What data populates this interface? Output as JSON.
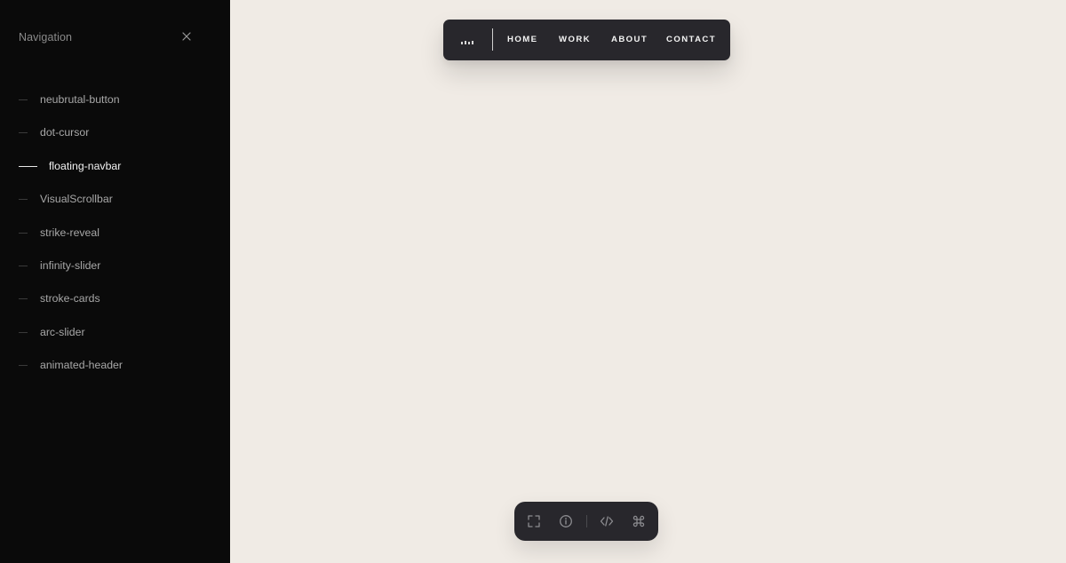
{
  "sidebar": {
    "title": "Navigation",
    "items": [
      {
        "label": "neubrutal-button",
        "active": false
      },
      {
        "label": "dot-cursor",
        "active": false
      },
      {
        "label": "floating-navbar",
        "active": true
      },
      {
        "label": "VisualScrollbar",
        "active": false
      },
      {
        "label": "strike-reveal",
        "active": false
      },
      {
        "label": "infinity-slider",
        "active": false
      },
      {
        "label": "stroke-cards",
        "active": false
      },
      {
        "label": "arc-slider",
        "active": false
      },
      {
        "label": "animated-header",
        "active": false
      }
    ],
    "close_icon": "close-icon"
  },
  "navbar": {
    "links": [
      "HOME",
      "WORK",
      "ABOUT",
      "CONTACT"
    ],
    "logo_icon": "bars-logo-icon"
  },
  "toolbar": {
    "icons": [
      "fullscreen-icon",
      "info-icon",
      "code-icon",
      "command-icon"
    ]
  },
  "colors": {
    "sidebar_bg": "#0a0a0a",
    "canvas_bg": "#f0ebe5",
    "navbar_bg": "#28272c",
    "active_text": "#f2f2f2",
    "muted_text": "#a8a8a8"
  }
}
